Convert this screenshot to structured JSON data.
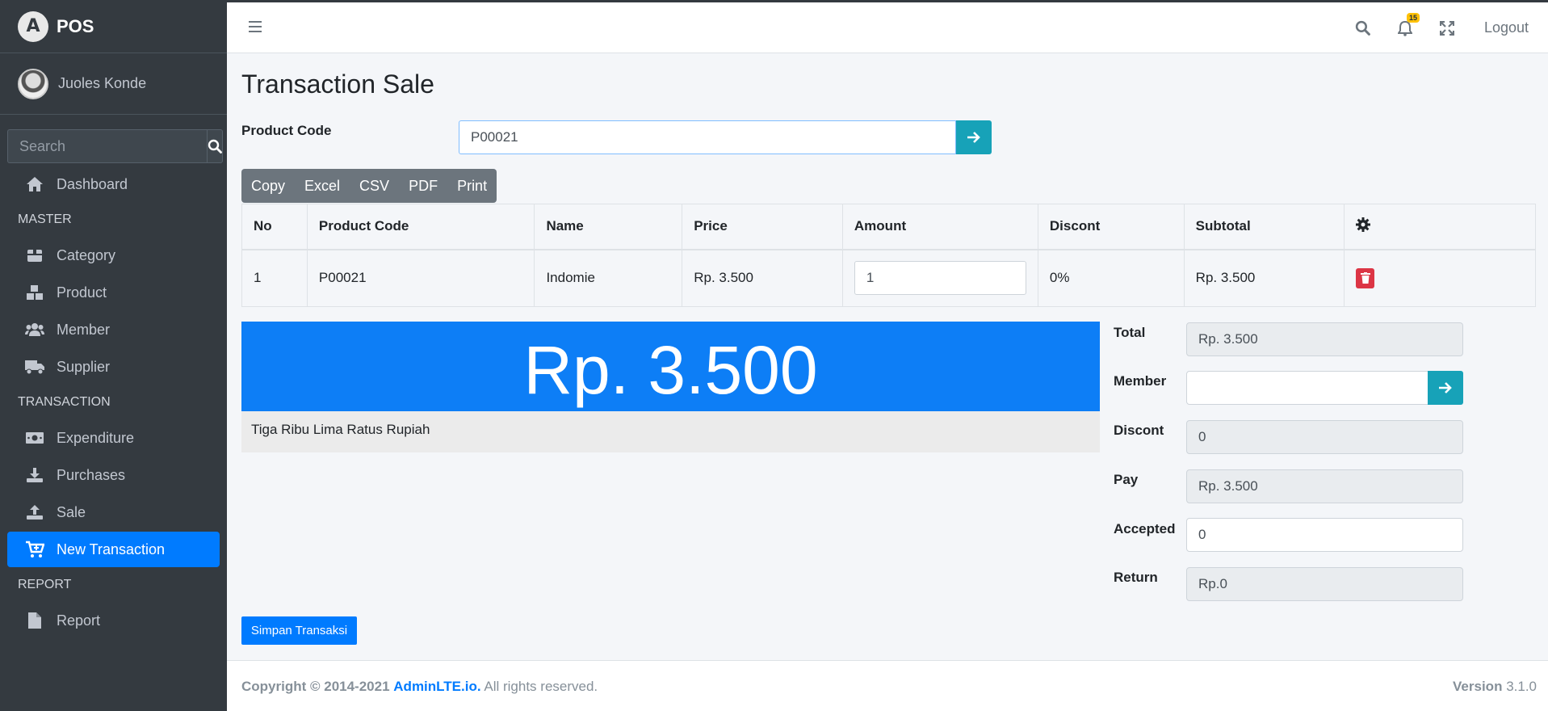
{
  "brand": {
    "logo_letter": "A",
    "name": "POS"
  },
  "user": {
    "name": "Juoles Konde"
  },
  "sidebar": {
    "search_placeholder": "Search",
    "items": [
      {
        "type": "item",
        "label": "Dashboard",
        "icon": "home-icon"
      },
      {
        "type": "header",
        "label": "MASTER"
      },
      {
        "type": "item",
        "label": "Category",
        "icon": "cube-icon"
      },
      {
        "type": "item",
        "label": "Product",
        "icon": "cubes-icon"
      },
      {
        "type": "item",
        "label": "Member",
        "icon": "users-icon"
      },
      {
        "type": "item",
        "label": "Supplier",
        "icon": "truck-icon"
      },
      {
        "type": "header",
        "label": "TRANSACTION"
      },
      {
        "type": "item",
        "label": "Expenditure",
        "icon": "money-icon"
      },
      {
        "type": "item",
        "label": "Purchases",
        "icon": "download-icon"
      },
      {
        "type": "item",
        "label": "Sale",
        "icon": "upload-icon"
      },
      {
        "type": "item",
        "label": "New Transaction",
        "icon": "cart-plus-icon",
        "active": true
      },
      {
        "type": "header",
        "label": "REPORT"
      },
      {
        "type": "item",
        "label": "Report",
        "icon": "file-icon"
      }
    ]
  },
  "navbar": {
    "notification_count": "15",
    "logout_label": "Logout"
  },
  "page": {
    "title": "Transaction Sale"
  },
  "product_code": {
    "label": "Product Code",
    "value": "P00021"
  },
  "export_buttons": [
    "Copy",
    "Excel",
    "CSV",
    "PDF",
    "Print"
  ],
  "table": {
    "headers": [
      "No",
      "Product Code",
      "Name",
      "Price",
      "Amount",
      "Discont",
      "Subtotal"
    ],
    "rows": [
      {
        "no": "1",
        "code": "P00021",
        "name": "Indomie",
        "price": "Rp. 3.500",
        "amount": "1",
        "discount": "0%",
        "subtotal": "Rp. 3.500"
      }
    ]
  },
  "total_display": {
    "amount": "Rp. 3.500",
    "in_words": "Tiga Ribu Lima Ratus Rupiah"
  },
  "form": {
    "total_label": "Total",
    "total_value": "Rp. 3.500",
    "member_label": "Member",
    "member_value": "",
    "discount_label": "Discont",
    "discount_value": "0",
    "pay_label": "Pay",
    "pay_value": "Rp. 3.500",
    "accepted_label": "Accepted",
    "accepted_value": "0",
    "return_label": "Return",
    "return_value": "Rp.0"
  },
  "save_button": "Simpan Transaksi",
  "footer": {
    "copyright": "Copyright © 2014-2021",
    "brand_link": "AdminLTE.io.",
    "rights": "All rights reserved.",
    "version_label": "Version",
    "version_value": "3.1.0"
  },
  "colors": {
    "accent": "#007bff",
    "teal": "#17a2b8",
    "danger": "#dc3545",
    "sidebar": "#343a40"
  }
}
